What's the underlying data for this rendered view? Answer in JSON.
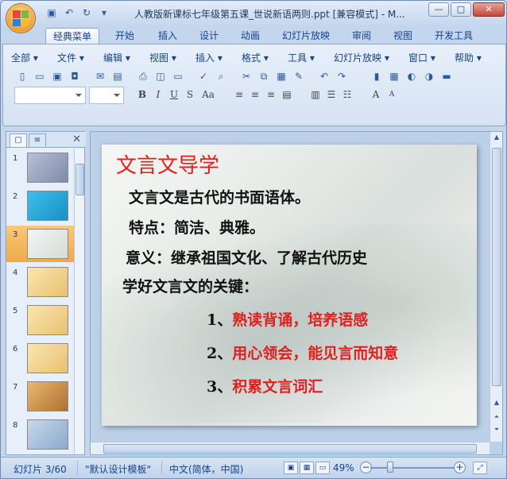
{
  "window": {
    "title": "人教版新课标七年级第五课_世说新语两则.ppt [兼容模式] - M...",
    "minimize": "—",
    "maximize": "□",
    "close": "✕"
  },
  "qat": {
    "save_icon": "save-icon",
    "undo_icon": "undo-icon",
    "redo_icon": "redo-icon",
    "more": "▾"
  },
  "tabs": [
    "经典菜单",
    "开始",
    "插入",
    "设计",
    "动画",
    "幻灯片放映",
    "审阅",
    "视图",
    "开发工具"
  ],
  "menu": [
    "全部 ▾",
    "文件 ▾",
    "编辑 ▾",
    "视图 ▾",
    "插入 ▾",
    "格式 ▾",
    "工具 ▾",
    "幻灯片放映 ▾",
    "窗口 ▾",
    "帮助 ▾"
  ],
  "format": {
    "bold": "B",
    "italic": "I",
    "underline": "U",
    "strike": "S",
    "case": "Aa",
    "grow": "A",
    "shrink": "A"
  },
  "left_panel": {
    "tab_slides": "▢",
    "tab_outline": "≡",
    "close": "✕",
    "thumbnails": [
      "1",
      "2",
      "3",
      "4",
      "5",
      "6",
      "7",
      "8"
    ],
    "selected": 3
  },
  "slide": {
    "title": "文言文导学",
    "line1": "文言文是古代的书面语体。",
    "line2": "特点：简洁、典雅。",
    "line3": "意义：继承祖国文化、了解古代历史",
    "line4": "学好文言文的关键：",
    "item1_num": "1、",
    "item1_text": "熟读背诵，培养语感",
    "item2_num": "2、",
    "item2_text": "用心领会，能见言而知意",
    "item3_num": "3、",
    "item3_text": "积累文言词汇"
  },
  "status": {
    "slide_count": "幻灯片 3/60",
    "template": "\"默认设计模板\"",
    "language": "中文(简体，中国)",
    "zoom": "49%",
    "zoom_minus": "−",
    "zoom_plus": "+"
  },
  "colors": {
    "accent_red": "#e02020",
    "ribbon_blue": "#c4d6ee",
    "selected_thumb": "#f0a94a"
  }
}
